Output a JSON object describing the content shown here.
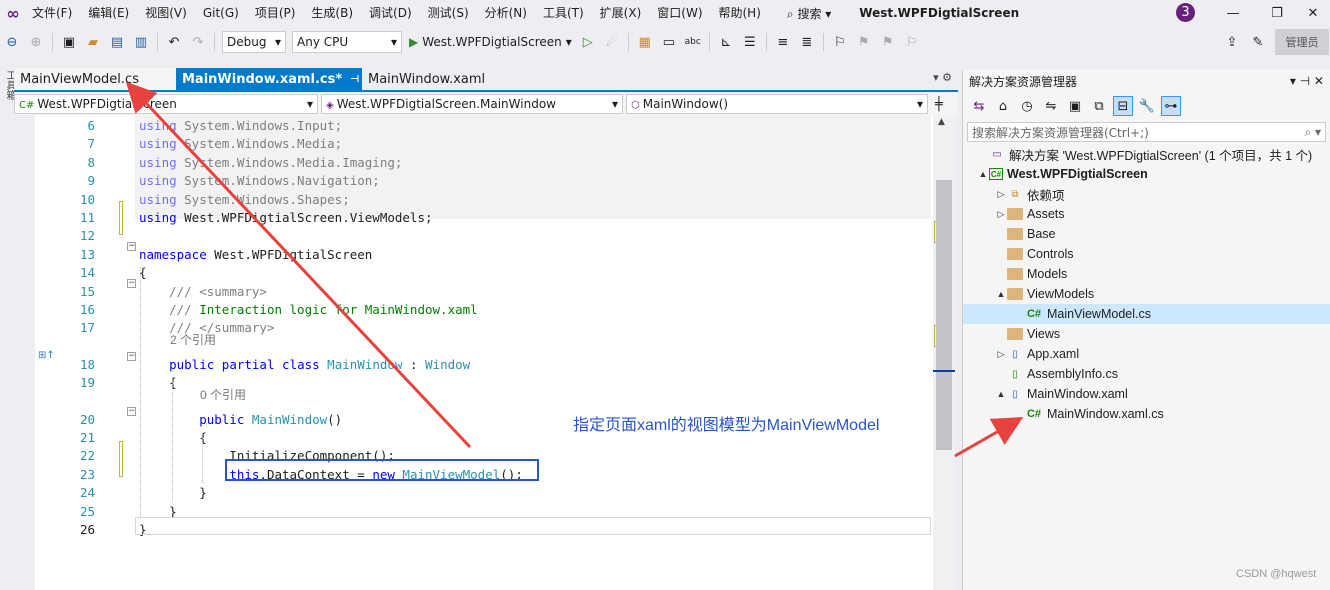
{
  "menu": {
    "items": [
      "文件(F)",
      "编辑(E)",
      "视图(V)",
      "Git(G)",
      "项目(P)",
      "生成(B)",
      "调试(D)",
      "测试(S)",
      "分析(N)",
      "工具(T)",
      "扩展(X)",
      "窗口(W)",
      "帮助(H)"
    ],
    "search_label": "搜索",
    "solution_title": "West.WPFDigtialScreen",
    "notification_count": "3"
  },
  "toolbar": {
    "config": "Debug",
    "platform": "Any CPU",
    "start_label": "West.WPFDigtialScreen",
    "admin_label": "管理员"
  },
  "left_strip_label": "工具箱",
  "tabs": [
    {
      "label": "MainViewModel.cs"
    },
    {
      "label": "MainWindow.xaml.cs*"
    },
    {
      "label": "MainWindow.xaml"
    }
  ],
  "navbar": {
    "project": "West.WPFDigtialScreen",
    "type": "West.WPFDigtialScreen.MainWindow",
    "member": "MainWindow()"
  },
  "code_lines": [
    {
      "n": "6",
      "parts": [
        {
          "t": "using ",
          "c": "kw fade"
        },
        {
          "t": "System.Windows.Input;",
          "c": "fade"
        }
      ]
    },
    {
      "n": "7",
      "parts": [
        {
          "t": "using ",
          "c": "kw fade"
        },
        {
          "t": "System.Windows.Media;",
          "c": "fade"
        }
      ]
    },
    {
      "n": "8",
      "parts": [
        {
          "t": "using ",
          "c": "kw fade"
        },
        {
          "t": "System.Windows.Media.Imaging;",
          "c": "fade"
        }
      ]
    },
    {
      "n": "9",
      "parts": [
        {
          "t": "using ",
          "c": "kw fade"
        },
        {
          "t": "System.Windows.Navigation;",
          "c": "fade"
        }
      ]
    },
    {
      "n": "10",
      "parts": [
        {
          "t": "using ",
          "c": "kw fade"
        },
        {
          "t": "System.Windows.Shapes;",
          "c": "fade"
        }
      ]
    },
    {
      "n": "11",
      "parts": [
        {
          "t": "using ",
          "c": "kw"
        },
        {
          "t": "West.WPFDigtialScreen.ViewModels;",
          "c": ""
        }
      ]
    },
    {
      "n": "12",
      "parts": []
    },
    {
      "n": "13",
      "parts": [
        {
          "t": "namespace ",
          "c": "kw"
        },
        {
          "t": "West.WPFDigtialScreen",
          "c": ""
        }
      ]
    },
    {
      "n": "14",
      "parts": [
        {
          "t": "{",
          "c": ""
        }
      ]
    },
    {
      "n": "15",
      "parts": [
        {
          "t": "    /// ",
          "c": "cmg"
        },
        {
          "t": "<summary>",
          "c": "cmg"
        }
      ]
    },
    {
      "n": "16",
      "parts": [
        {
          "t": "    /// ",
          "c": "cmg"
        },
        {
          "t": "Interaction logic for MainWindow.xaml",
          "c": "cm"
        }
      ]
    },
    {
      "n": "17",
      "parts": [
        {
          "t": "    /// ",
          "c": "cmg"
        },
        {
          "t": "</summary>",
          "c": "cmg"
        }
      ]
    },
    {
      "n": "18",
      "parts": [
        {
          "t": "    public ",
          "c": "kw"
        },
        {
          "t": "partial ",
          "c": "kw"
        },
        {
          "t": "class ",
          "c": "kw"
        },
        {
          "t": "MainWindow",
          "c": "ty"
        },
        {
          "t": " : ",
          "c": ""
        },
        {
          "t": "Window",
          "c": "ty"
        }
      ]
    },
    {
      "n": "19",
      "parts": [
        {
          "t": "    {",
          "c": ""
        }
      ]
    },
    {
      "n": "20",
      "parts": [
        {
          "t": "        public ",
          "c": "kw"
        },
        {
          "t": "MainWindow",
          "c": "ty"
        },
        {
          "t": "()",
          "c": ""
        }
      ]
    },
    {
      "n": "21",
      "parts": [
        {
          "t": "        {",
          "c": ""
        }
      ]
    },
    {
      "n": "22",
      "parts": [
        {
          "t": "            InitializeComponent();",
          "c": ""
        }
      ]
    },
    {
      "n": "23",
      "parts": [
        {
          "t": "            ",
          "c": ""
        },
        {
          "t": "this",
          "c": "kw"
        },
        {
          "t": ".DataContext = ",
          "c": ""
        },
        {
          "t": "new ",
          "c": "kw"
        },
        {
          "t": "MainViewModel",
          "c": "ty"
        },
        {
          "t": "();",
          "c": ""
        }
      ]
    },
    {
      "n": "24",
      "parts": [
        {
          "t": "        }",
          "c": ""
        }
      ]
    },
    {
      "n": "25",
      "parts": [
        {
          "t": "    }",
          "c": ""
        }
      ]
    },
    {
      "n": "26",
      "parts": [
        {
          "t": "}",
          "c": ""
        }
      ]
    }
  ],
  "refs": {
    "class_refs": "2 个引用",
    "ctor_refs": "0 个引用"
  },
  "annotation": "指定页面xaml的视图模型为MainViewModel",
  "solution_explorer": {
    "title": "解决方案资源管理器",
    "search_placeholder": "搜索解决方案资源管理器(Ctrl+;)",
    "tree": [
      {
        "label": "解决方案 'West.WPFDigtialScreen' (1 个项目，共 1 个)",
        "icon": "solution",
        "arrow": "",
        "indent": 0
      },
      {
        "label": "West.WPFDigtialScreen",
        "icon": "project",
        "arrow": "▲",
        "indent": 0,
        "bold": true
      },
      {
        "label": "依赖项",
        "icon": "deps",
        "arrow": "▷",
        "indent": 1
      },
      {
        "label": "Assets",
        "icon": "folder",
        "arrow": "▷",
        "indent": 1
      },
      {
        "label": "Base",
        "icon": "folder",
        "arrow": "",
        "indent": 1
      },
      {
        "label": "Controls",
        "icon": "folder",
        "arrow": "",
        "indent": 1
      },
      {
        "label": "Models",
        "icon": "folder",
        "arrow": "",
        "indent": 1
      },
      {
        "label": "ViewModels",
        "icon": "folder",
        "arrow": "▲",
        "indent": 1
      },
      {
        "label": "MainViewModel.cs",
        "icon": "cs",
        "arrow": "",
        "indent": 2,
        "selected": true
      },
      {
        "label": "Views",
        "icon": "folder",
        "arrow": "",
        "indent": 1
      },
      {
        "label": "App.xaml",
        "icon": "xaml",
        "arrow": "▷",
        "indent": 1
      },
      {
        "label": "AssemblyInfo.cs",
        "icon": "csfile",
        "arrow": "",
        "indent": 1
      },
      {
        "label": "MainWindow.xaml",
        "icon": "xaml",
        "arrow": "▲",
        "indent": 1
      },
      {
        "label": "MainWindow.xaml.cs",
        "icon": "cs",
        "arrow": "",
        "indent": 2
      }
    ]
  },
  "watermark": "CSDN @hqwest",
  "colors": {
    "accent": "#007acc",
    "arrow": "#e8423f",
    "annotation": "#2a55c9"
  }
}
